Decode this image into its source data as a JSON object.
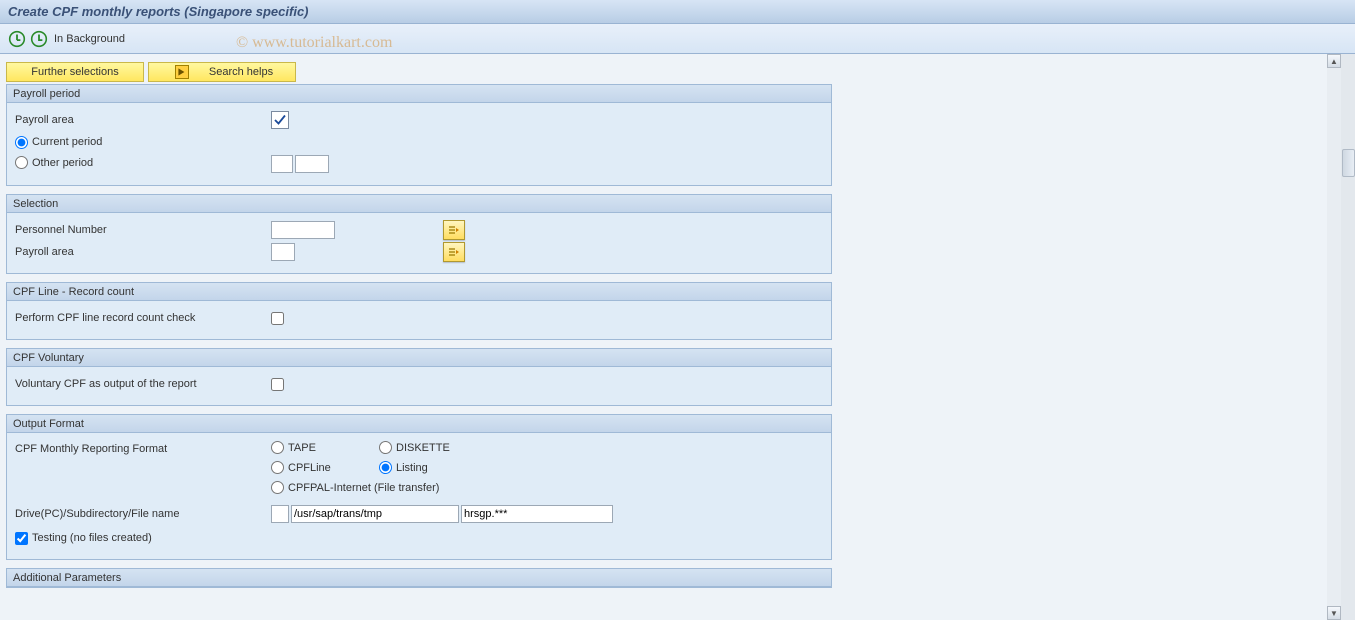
{
  "title": "Create CPF monthly reports (Singapore specific)",
  "toolbar": {
    "in_background": "In Background"
  },
  "watermark": "© www.tutorialkart.com",
  "buttons": {
    "further_selections": "Further selections",
    "search_helps": "Search helps"
  },
  "groups": {
    "payroll_period": {
      "title": "Payroll period",
      "payroll_area_label": "Payroll area",
      "current_period": "Current period",
      "other_period": "Other period"
    },
    "selection": {
      "title": "Selection",
      "personnel_number": "Personnel Number",
      "payroll_area": "Payroll area"
    },
    "cpf_line": {
      "title": "CPF Line - Record count",
      "label": "Perform CPF line  record count check"
    },
    "cpf_voluntary": {
      "title": "CPF Voluntary",
      "label": "Voluntary CPF as output of the report"
    },
    "output_format": {
      "title": "Output Format",
      "reporting_format": "CPF Monthly Reporting Format",
      "tape": "TAPE",
      "diskette": "DISKETTE",
      "cpfline": "CPFLine",
      "listing": "Listing",
      "cpfpal": "CPFPAL-Internet (File transfer)",
      "drive_label": "Drive(PC)/Subdirectory/File name",
      "path_value": "/usr/sap/trans/tmp",
      "filename_value": "hrsgp.***",
      "testing": "Testing (no files created)"
    },
    "additional": {
      "title": "Additional Parameters"
    }
  }
}
